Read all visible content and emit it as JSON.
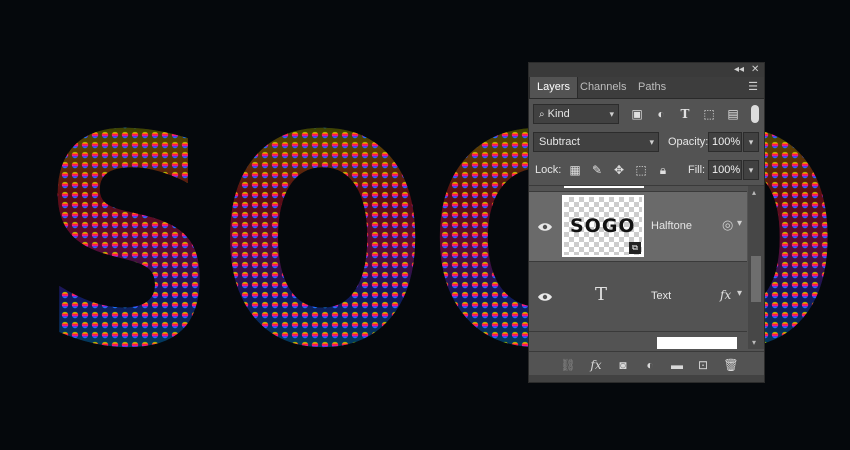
{
  "canvas": {
    "artwork_text": "SOGO",
    "background_color": "#05080c",
    "gradient_colors": [
      "#1fbf00",
      "#ffb000",
      "#ff2030",
      "#ff1a8a",
      "#3040ff",
      "#00a8ff"
    ]
  },
  "panel": {
    "collapse_glyph": "◂◂",
    "close_glyph": "✕",
    "tabs": [
      {
        "label": "Layers",
        "active": true
      },
      {
        "label": "Channels",
        "active": false
      },
      {
        "label": "Paths",
        "active": false
      }
    ],
    "filter": {
      "kind_label": "Kind",
      "icons": [
        "image-filter-icon",
        "adjustment-filter-icon",
        "type-filter-icon",
        "shape-filter-icon",
        "smart-object-filter-icon"
      ]
    },
    "blend_mode": "Subtract",
    "opacity_label": "Opacity:",
    "opacity_value": "100%",
    "lock_label": "Lock:",
    "lock_icons": [
      "lock-transparent-icon",
      "lock-image-icon",
      "lock-position-icon",
      "lock-artboard-icon",
      "lock-all-icon"
    ],
    "fill_label": "Fill:",
    "fill_value": "100%",
    "layers": [
      {
        "name": "Halftone",
        "visible": true,
        "type": "smart-object",
        "thumbnail_text": "SOGO"
      },
      {
        "name": "Text",
        "visible": true,
        "type": "type",
        "type_glyph": "T",
        "fx_glyph": "fx"
      }
    ],
    "footer_icons": [
      "link-layers-icon",
      "fx-icon",
      "mask-icon",
      "adjustment-icon",
      "folder-icon",
      "new-layer-icon",
      "trash-icon"
    ]
  }
}
